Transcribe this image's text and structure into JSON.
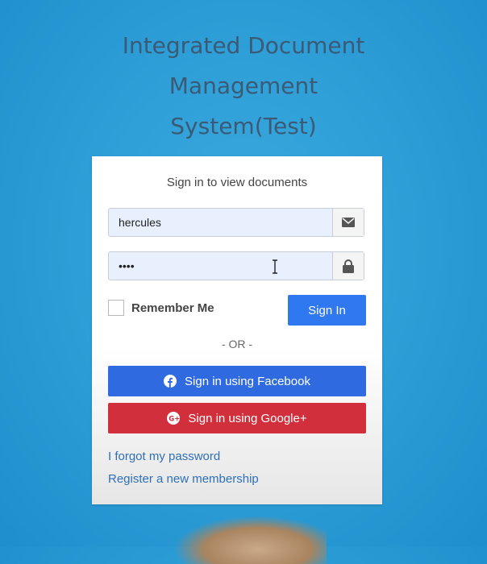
{
  "header": {
    "title_main": "Integrated Document Management System",
    "title_suffix": "(Test)"
  },
  "login": {
    "subtitle": "Sign in to view documents",
    "username_value": "hercules",
    "username_icon": "envelope-icon",
    "password_value": "••••",
    "password_icon": "lock-icon",
    "remember_label": "Remember Me",
    "remember_checked": false,
    "signin_label": "Sign In",
    "or_text": "- OR -",
    "facebook_label": "Sign in using Facebook",
    "google_label": "Sign in using Google+",
    "forgot_link": "I forgot my password",
    "register_link": "Register a new membership"
  },
  "colors": {
    "background": "#2f9fd8",
    "primary": "#2f78f0",
    "facebook": "#2f6ae0",
    "google": "#d22f3c",
    "link": "#2f6fb7"
  }
}
